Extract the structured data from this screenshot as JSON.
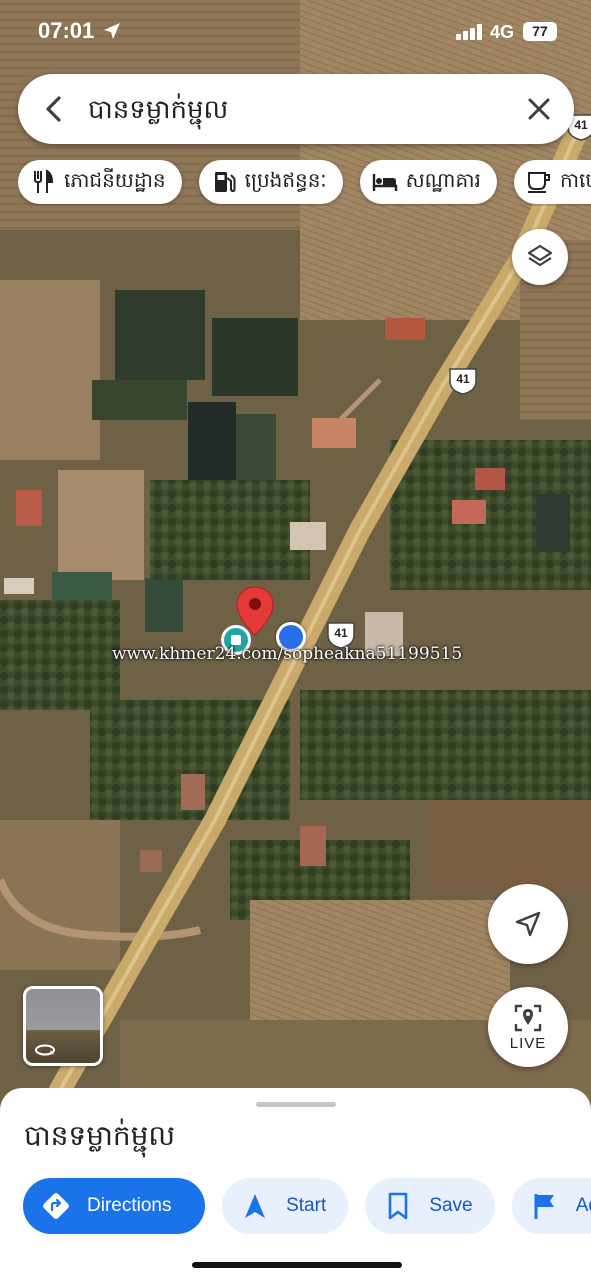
{
  "status_bar": {
    "time": "07:01",
    "network": "4G",
    "battery": "77"
  },
  "search": {
    "query": "បានទម្លាក់ម្ជុល"
  },
  "chips": [
    {
      "label": "ភោជនីយដ្ឋាន",
      "icon": "restaurant-icon"
    },
    {
      "label": "ប្រេងឥន្ធនៈ",
      "icon": "gas-station-icon"
    },
    {
      "label": "សណ្ឋាគារ",
      "icon": "hotel-icon"
    },
    {
      "label": "កាហ្វេ",
      "icon": "coffee-icon"
    }
  ],
  "map": {
    "route_shield_labels": [
      "41",
      "41",
      "41"
    ],
    "watermark": "www.khmer24.com/sopheakna51199515",
    "live_label": "LIVE",
    "colors": {
      "road": "#c9aa6a",
      "pin": "#e53935",
      "blue_dot": "#2b6ee9",
      "transit_dot": "#1fa5a2"
    }
  },
  "sheet": {
    "title": "បានទម្លាក់ម្ជុល",
    "actions": [
      {
        "label": "Directions",
        "icon": "directions-icon"
      },
      {
        "label": "Start",
        "icon": "navigation-arrow-icon"
      },
      {
        "label": "Save",
        "icon": "bookmark-icon"
      },
      {
        "label": "Ad",
        "icon": "flag-icon"
      }
    ],
    "accent": "#1a73e8"
  }
}
